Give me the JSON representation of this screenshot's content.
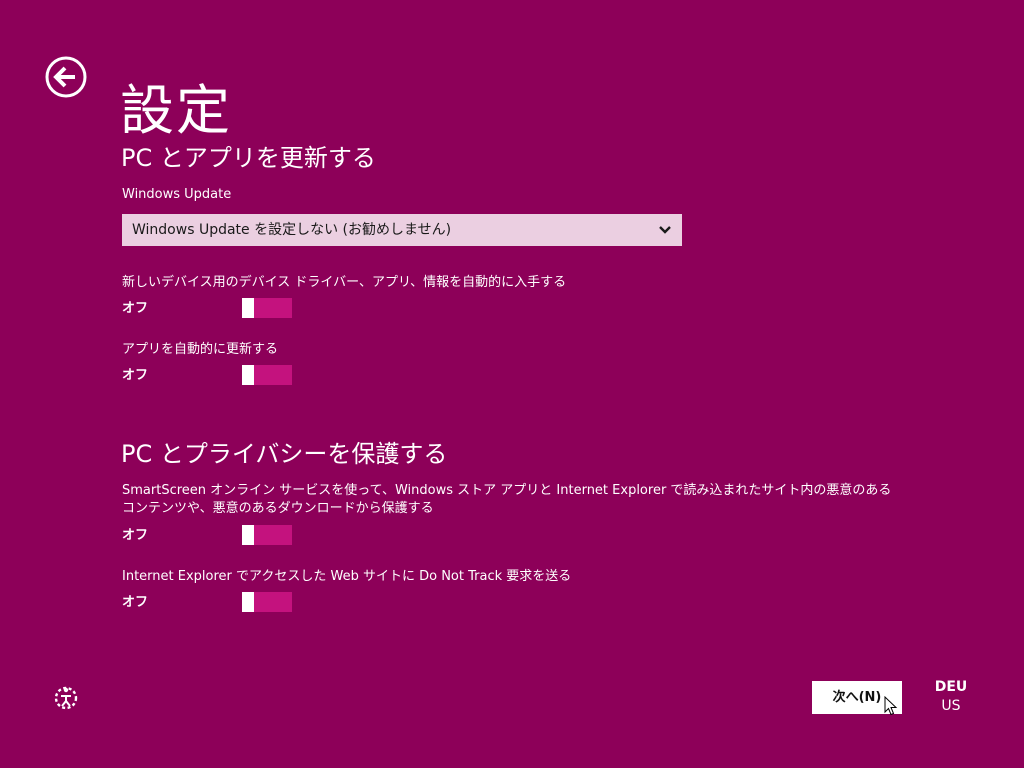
{
  "header": {
    "title": "設定"
  },
  "update_section": {
    "title": "PC とアプリを更新する",
    "windows_update_label": "Windows Update",
    "windows_update_value": "Windows Update を設定しない (お勧めしません)",
    "driver_label": "新しいデバイス用のデバイス ドライバー、アプリ、情報を自動的に入手する",
    "driver_state": "オフ",
    "apps_label": "アプリを自動的に更新する",
    "apps_state": "オフ"
  },
  "privacy_section": {
    "title": "PC とプライバシーを保護する",
    "smartscreen_label": "SmartScreen オンライン サービスを使って、Windows ストア アプリと Internet Explorer で読み込まれたサイト内の悪意のあるコンテンツや、悪意のあるダウンロードから保護する",
    "smartscreen_state": "オフ",
    "dnt_label": "Internet Explorer でアクセスした Web サイトに Do Not Track 要求を送る",
    "dnt_state": "オフ"
  },
  "footer": {
    "next_label": "次へ(N)",
    "lang_primary": "DEU",
    "lang_secondary": "US"
  },
  "colors": {
    "background": "#8d0059",
    "toggle_accent": "#c4127e",
    "dropdown_bg": "#ebcfe1"
  },
  "icons": {
    "back": "back-arrow-circle-icon",
    "chevron": "chevron-down-icon",
    "accessibility": "ease-of-access-icon",
    "cursor": "mouse-pointer-icon"
  }
}
